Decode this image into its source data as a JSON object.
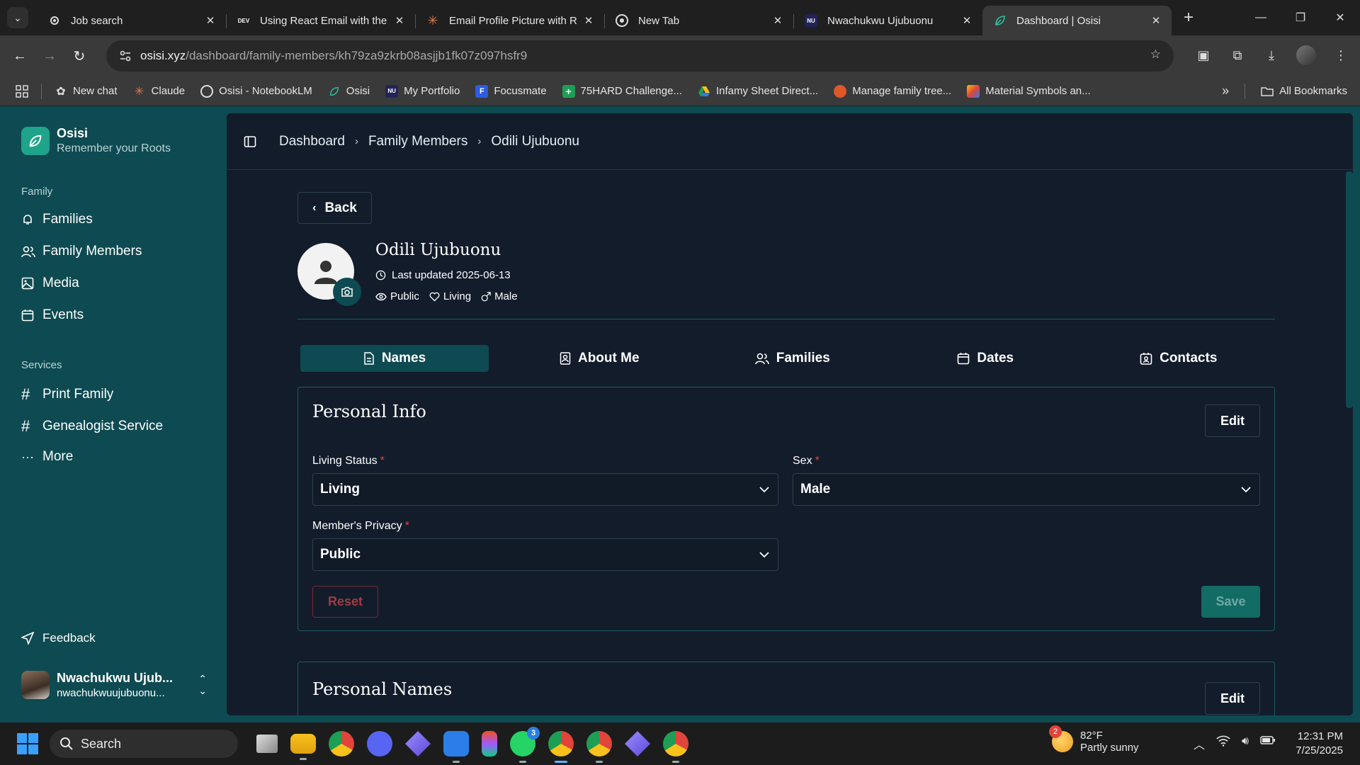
{
  "browser": {
    "tabs": [
      {
        "title": "Job search",
        "icon": "gear-icon",
        "active": false
      },
      {
        "title": "Using React Email with the",
        "icon": "dev-icon",
        "active": false
      },
      {
        "title": "Email Profile Picture with R",
        "icon": "claude-icon",
        "active": false
      },
      {
        "title": "New Tab",
        "icon": "chrome-icon",
        "active": false
      },
      {
        "title": "Nwachukwu Ujubuonu",
        "icon": "nu-icon",
        "active": false
      },
      {
        "title": "Dashboard | Osisi",
        "icon": "leaf-icon",
        "active": true
      }
    ],
    "dev_label": "DEV",
    "nu_label": "NU",
    "url_host": "osisi.xyz",
    "url_path": "/dashboard/family-members/kh79za9zkrb08asjjb1fk07z097hsfr9",
    "bookmarks": [
      {
        "label": "New chat",
        "icon": "openai-icon"
      },
      {
        "label": "Claude",
        "icon": "claude-icon"
      },
      {
        "label": "Osisi - NotebookLM",
        "icon": "notebooklm-icon"
      },
      {
        "label": "Osisi",
        "icon": "leaf-icon"
      },
      {
        "label": "My Portfolio",
        "icon": "nu-icon"
      },
      {
        "label": "Focusmate",
        "icon": "focusmate-icon"
      },
      {
        "label": "75HARD Challenge...",
        "icon": "sheets-icon"
      },
      {
        "label": "Infamy Sheet Direct...",
        "icon": "drive-icon"
      },
      {
        "label": "Manage family tree...",
        "icon": "familytree-icon"
      },
      {
        "label": "Material Symbols an...",
        "icon": "material-icon"
      }
    ],
    "focusmate_label": "F",
    "sheets_label": "+",
    "all_bookmarks": "All Bookmarks"
  },
  "sidebar": {
    "brand_name": "Osisi",
    "brand_tagline": "Remember your Roots",
    "group_family": "Family",
    "family_items": [
      "Families",
      "Family Members",
      "Media",
      "Events"
    ],
    "group_services": "Services",
    "services_items": [
      "Print Family",
      "Genealogist Service",
      "More"
    ],
    "feedback": "Feedback",
    "user_name": "Nwachukwu Ujub...",
    "user_email": "nwachukwuujubuonu..."
  },
  "breadcrumb": [
    "Dashboard",
    "Family Members",
    "Odili Ujubuonu"
  ],
  "profile": {
    "back_label": "Back",
    "name": "Odili Ujubuonu",
    "last_updated": "Last updated 2025-06-13",
    "privacy": "Public",
    "living": "Living",
    "sex": "Male"
  },
  "profile_tabs": [
    "Names",
    "About Me",
    "Families",
    "Dates",
    "Contacts"
  ],
  "personal_info": {
    "title": "Personal Info",
    "edit_label": "Edit",
    "living_status_label": "Living Status",
    "living_status_value": "Living",
    "sex_label": "Sex",
    "sex_value": "Male",
    "privacy_label": "Member's Privacy",
    "privacy_value": "Public",
    "reset_label": "Reset",
    "save_label": "Save",
    "required_mark": "*"
  },
  "personal_names": {
    "title": "Personal Names",
    "edit_label": "Edit"
  },
  "taskbar": {
    "search_label": "Search",
    "whatsapp_badge": "3",
    "weather_badge": "2",
    "temperature": "82°F",
    "weather_desc": "Partly sunny",
    "time": "12:31 PM",
    "date": "7/25/2025"
  }
}
